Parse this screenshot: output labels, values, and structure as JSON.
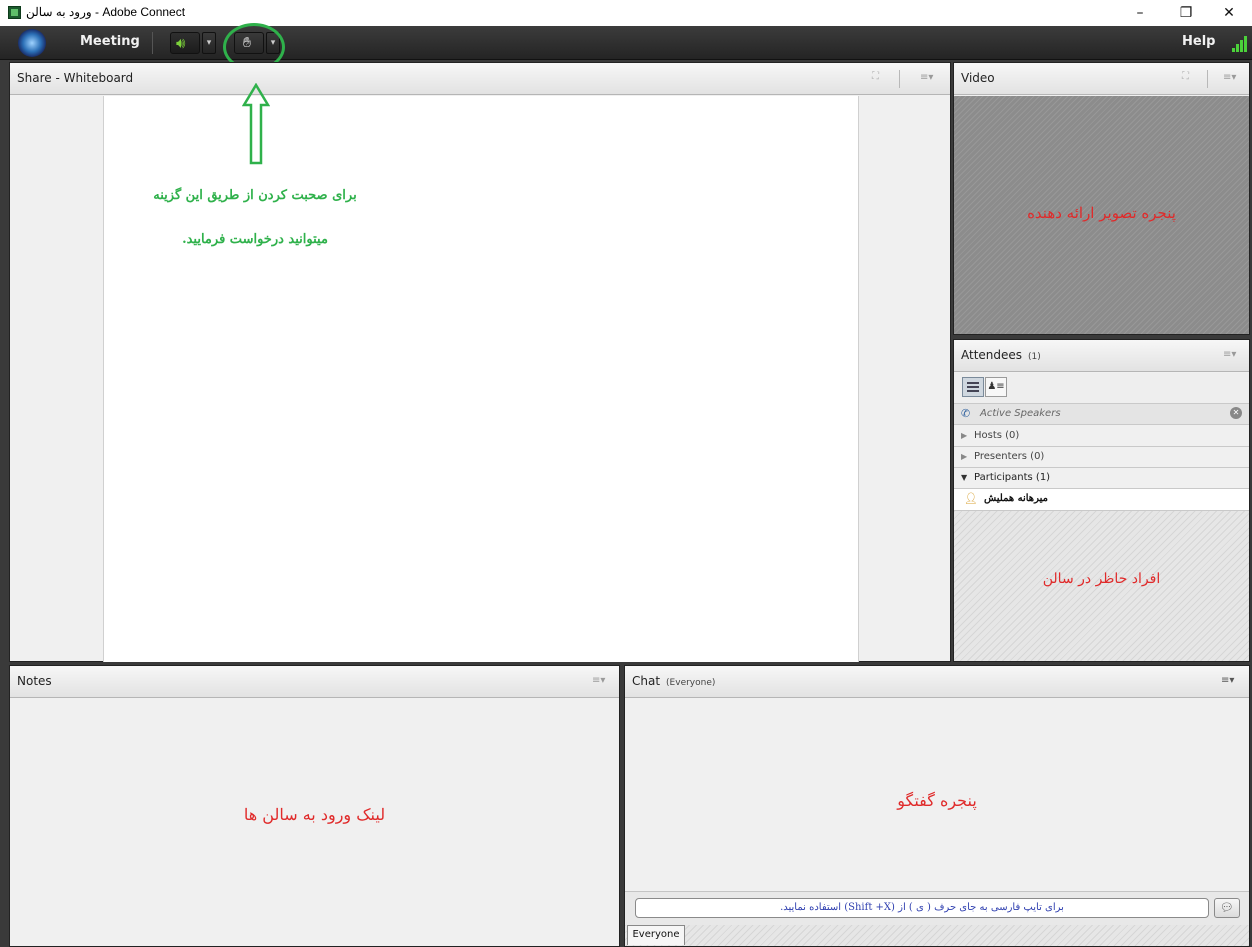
{
  "window": {
    "title": "ورود به سالن - Adobe Connect",
    "controls": {
      "minimize": "–",
      "restore": "❐",
      "close": "✕"
    }
  },
  "menubar": {
    "meeting_label": "Meeting",
    "help_label": "Help",
    "speaker_icon": "speaker-icon",
    "raise_hand_icon": "raise-hand-icon",
    "accent_green": "#7cd13a"
  },
  "whiteboard": {
    "title": "Share - Whiteboard",
    "annotation_line1": "برای صحبت کردن از طریق این گزینه",
    "annotation_line2": "میتوانید درخواست فرمایید."
  },
  "video": {
    "title": "Video",
    "annotation": "پنجره تصویر ارائه دهنده"
  },
  "attendees": {
    "title": "Attendees",
    "count": "(1)",
    "active_speakers": "Active Speakers",
    "hosts": "Hosts (0)",
    "presenters": "Presenters (0)",
    "participants": "Participants (1)",
    "participant_name": "میرهانه هملیش",
    "annotation": "افراد حاظر در سالن"
  },
  "notes": {
    "title": "Notes",
    "annotation": "لینک ورود به سالن ها"
  },
  "chat": {
    "title": "Chat",
    "scope": "(Everyone)",
    "annotation": "پنجره گفتگو",
    "input_hint": "برای تایپ فارسی به جای حرف ( ی ) از (Shift +X) استفاده نمایید.",
    "tab_everyone": "Everyone"
  },
  "colors": {
    "annotation_red": "#e02a2a",
    "annotation_green": "#2fb14b"
  }
}
